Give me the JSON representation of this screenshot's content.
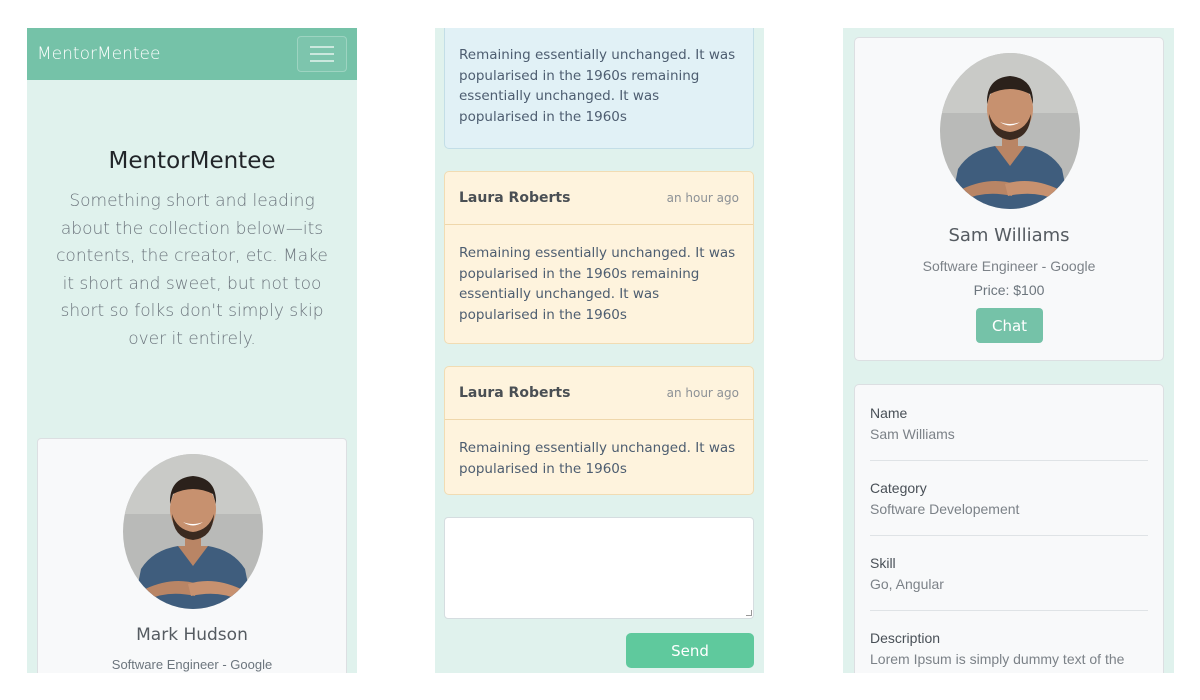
{
  "panel1": {
    "navbar": {
      "brand": "MentorMentee"
    },
    "hero": {
      "title": "MentorMentee",
      "text": "Something short and leading about the collection below—its contents, the creator, etc. Make it short and sweet, but not too short so folks don't simply skip over it entirely."
    },
    "card": {
      "name": "Mark Hudson",
      "subtitle": "Software Engineer - Google"
    }
  },
  "panel2": {
    "messages": [
      {
        "author": "",
        "time": "",
        "body": "Remaining essentially unchanged. It was popularised in the 1960s remaining essentially unchanged. It was popularised in the 1960s",
        "style": "info"
      },
      {
        "author": "Laura Roberts",
        "time": "an hour ago",
        "body": "Remaining essentially unchanged. It was popularised in the 1960s remaining essentially unchanged. It was popularised in the 1960s",
        "style": "warning"
      },
      {
        "author": "Laura Roberts",
        "time": "an hour ago",
        "body": "Remaining essentially unchanged. It was popularised in the 1960s",
        "style": "warning"
      }
    ],
    "input": {
      "value": ""
    },
    "send_label": "Send"
  },
  "panel3": {
    "profile": {
      "name": "Sam Williams",
      "subtitle": "Software Engineer - Google",
      "price": "Price: $100",
      "chat_label": "Chat"
    },
    "details": [
      {
        "label": "Name",
        "value": "Sam Williams"
      },
      {
        "label": "Category",
        "value": "Software Developement"
      },
      {
        "label": "Skill",
        "value": "Go, Angular"
      },
      {
        "label": "Description",
        "value": "Lorem Ipsum is simply dummy text of the"
      }
    ]
  },
  "colors": {
    "panel_bg": "#e0f2ed",
    "navbar": "#75c2a8",
    "chat_button": "#75c2a8",
    "send_button": "#5fc99d",
    "info_message": "#e1f1f6",
    "warning_message": "#fef3dd"
  }
}
